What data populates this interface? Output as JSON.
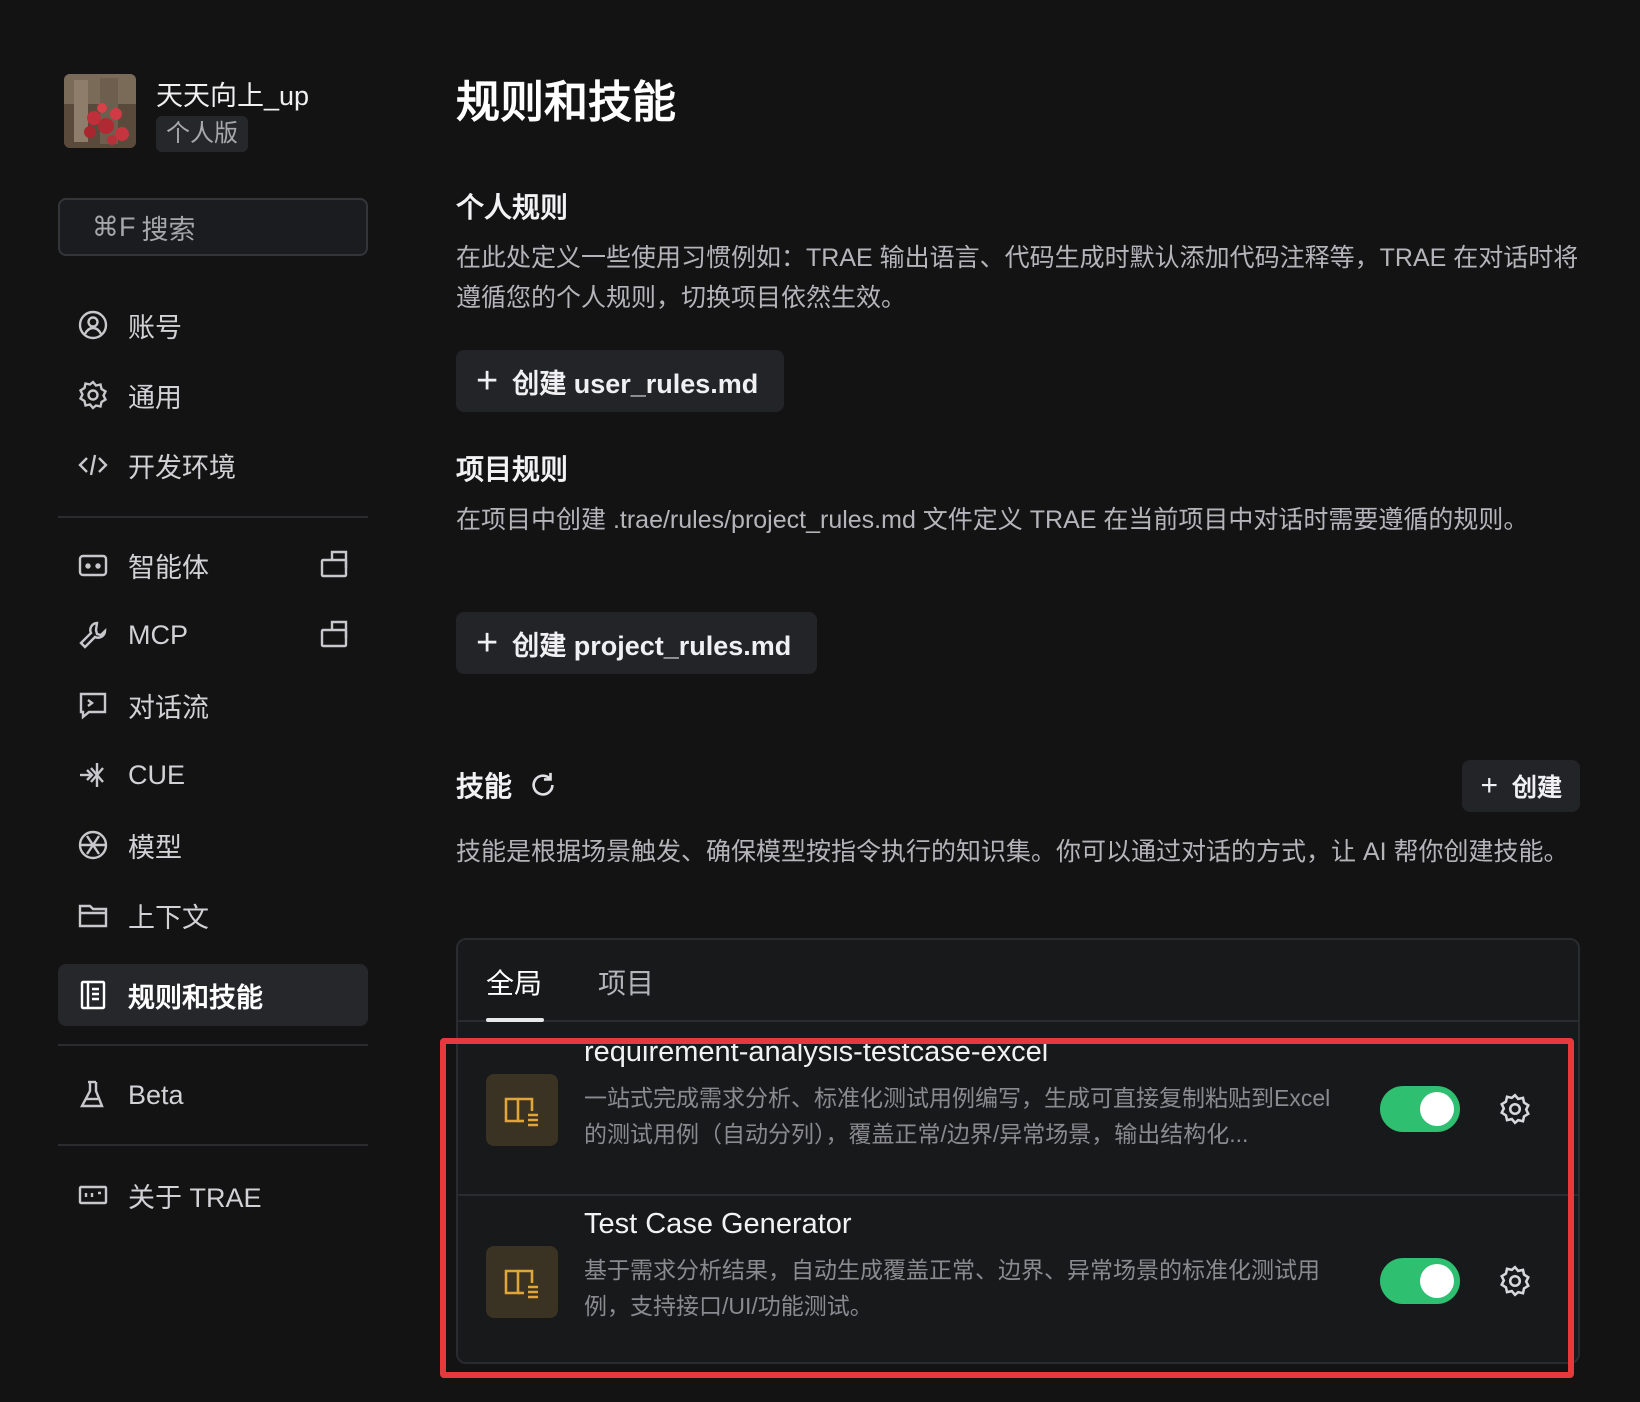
{
  "profile": {
    "username": "天天向上_up",
    "edition": "个人版"
  },
  "search": {
    "shortcut": "⌘F",
    "label": "搜索"
  },
  "sidebar": {
    "items": [
      {
        "label": "账号",
        "icon": "account-icon"
      },
      {
        "label": "通用",
        "icon": "gear-icon"
      },
      {
        "label": "开发环境",
        "icon": "code-icon"
      },
      {
        "label": "智能体",
        "icon": "agent-icon"
      },
      {
        "label": "MCP",
        "icon": "wrench-icon"
      },
      {
        "label": "对话流",
        "icon": "chat-flow-icon"
      },
      {
        "label": "CUE",
        "icon": "cue-icon"
      },
      {
        "label": "模型",
        "icon": "model-icon"
      },
      {
        "label": "上下文",
        "icon": "folder-icon"
      },
      {
        "label": "规则和技能",
        "icon": "rules-icon",
        "active": true
      },
      {
        "label": "Beta",
        "icon": "flask-icon"
      },
      {
        "label": "关于 TRAE",
        "icon": "about-icon"
      }
    ]
  },
  "main": {
    "title": "规则和技能",
    "personal_rules": {
      "title": "个人规则",
      "description": "在此处定义一些使用习惯例如：TRAE 输出语言、代码生成时默认添加代码注释等，TRAE 在对话时将遵循您的个人规则，切换项目依然生效。",
      "button": "创建 user_rules.md"
    },
    "project_rules": {
      "title": "项目规则",
      "description": "在项目中创建 .trae/rules/project_rules.md 文件定义 TRAE 在当前项目中对话时需要遵循的规则。",
      "button": "创建 project_rules.md"
    },
    "skills": {
      "title": "技能",
      "create_button": "创建",
      "description": "技能是根据场景触发、确保模型按指令执行的知识集。你可以通过对话的方式，让 AI 帮你创建技能。",
      "tabs": [
        "全局",
        "项目"
      ],
      "active_tab": "全局",
      "items": [
        {
          "name": "requirement-analysis-testcase-excel",
          "description": "一站式完成需求分析、标准化测试用例编写，生成可直接复制粘贴到Excel的测试用例（自动分列），覆盖正常/边界/异常场景，输出结构化...",
          "enabled": true
        },
        {
          "name": "Test Case Generator",
          "description": "基于需求分析结果，自动生成覆盖正常、边界、异常场景的标准化测试用例，支持接口/UI/功能测试。",
          "enabled": true
        }
      ]
    }
  },
  "colors": {
    "background": "#131314",
    "toggle_on": "#2fbf71",
    "highlight": "#e5393f",
    "skill_icon_bg": "#3a3223",
    "skill_icon_fg": "#e0a63a"
  }
}
